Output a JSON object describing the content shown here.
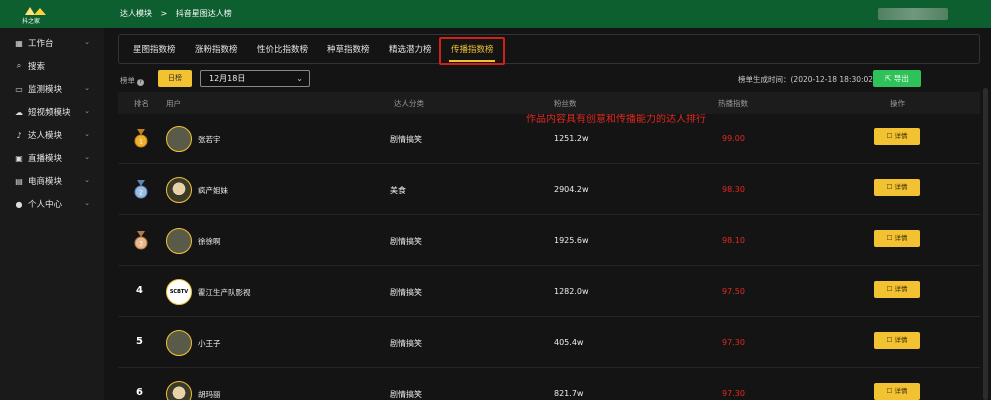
{
  "header": {
    "logo_text": "抖之家",
    "breadcrumb": [
      "达人模块",
      ">",
      "抖音星图达人榜"
    ]
  },
  "sidebar": {
    "items": [
      {
        "label": "工作台",
        "icon": "dashboard-icon",
        "glyph": "▦",
        "chevron": true
      },
      {
        "label": "搜索",
        "icon": "search-icon",
        "glyph": "⌕",
        "chevron": false
      },
      {
        "label": "监测模块",
        "icon": "monitor-icon",
        "glyph": "▭",
        "chevron": true
      },
      {
        "label": "短视频模块",
        "icon": "cloud-icon",
        "glyph": "☁",
        "chevron": true
      },
      {
        "label": "达人模块",
        "icon": "tiktok-icon",
        "glyph": "♪",
        "chevron": true
      },
      {
        "label": "直播模块",
        "icon": "live-icon",
        "glyph": "▣",
        "chevron": true
      },
      {
        "label": "电商模块",
        "icon": "shop-icon",
        "glyph": "▤",
        "chevron": true
      },
      {
        "label": "个人中心",
        "icon": "user-icon",
        "glyph": "●",
        "chevron": true
      }
    ]
  },
  "tabs": [
    {
      "label": "星图指数榜"
    },
    {
      "label": "涨粉指数榜"
    },
    {
      "label": "性价比指数榜"
    },
    {
      "label": "种草指数榜"
    },
    {
      "label": "精选潜力榜"
    },
    {
      "label": "传播指数榜",
      "active": true
    }
  ],
  "filter": {
    "label": "榜单",
    "period_button": "日榜",
    "date_value": "12月18日",
    "annotation": "作品内容具有创意和传播能力的达人排行",
    "generated_label": "榜单生成时间：(2020-12-18 18:30:02)",
    "export_label": "导出"
  },
  "table": {
    "columns": [
      "排名",
      "用户",
      "达人分类",
      "粉丝数",
      "热播指数",
      "操作"
    ],
    "rows": [
      {
        "rank": "1",
        "medal": "gold",
        "name": "张若宇",
        "category": "剧情搞笑",
        "fans": "1251.2w",
        "score": "99.00",
        "action": "详情"
      },
      {
        "rank": "2",
        "medal": "silver",
        "name": "疯产姐妹",
        "category": "美食",
        "fans": "2904.2w",
        "score": "98.30",
        "action": "详情"
      },
      {
        "rank": "3",
        "medal": "bronze",
        "name": "徐徐啊",
        "category": "剧情搞笑",
        "fans": "1925.6w",
        "score": "98.10",
        "action": "详情"
      },
      {
        "rank": "4",
        "medal": "",
        "name": "霍江生产队影视",
        "category": "剧情搞笑",
        "fans": "1282.0w",
        "score": "97.50",
        "action": "详情",
        "avatar_text": "SCBTV"
      },
      {
        "rank": "5",
        "medal": "",
        "name": "小王子",
        "category": "剧情搞笑",
        "fans": "405.4w",
        "score": "97.30",
        "action": "详情"
      },
      {
        "rank": "6",
        "medal": "",
        "name": "胡玛丽",
        "category": "剧情搞笑",
        "fans": "821.7w",
        "score": "97.30",
        "action": "详情"
      }
    ]
  },
  "colors": {
    "header_bg": "#0e5f2f",
    "accent": "#f2c233",
    "export_green": "#2fc25b",
    "score_red": "#e22a22",
    "annotation_red": "#e0281f"
  }
}
